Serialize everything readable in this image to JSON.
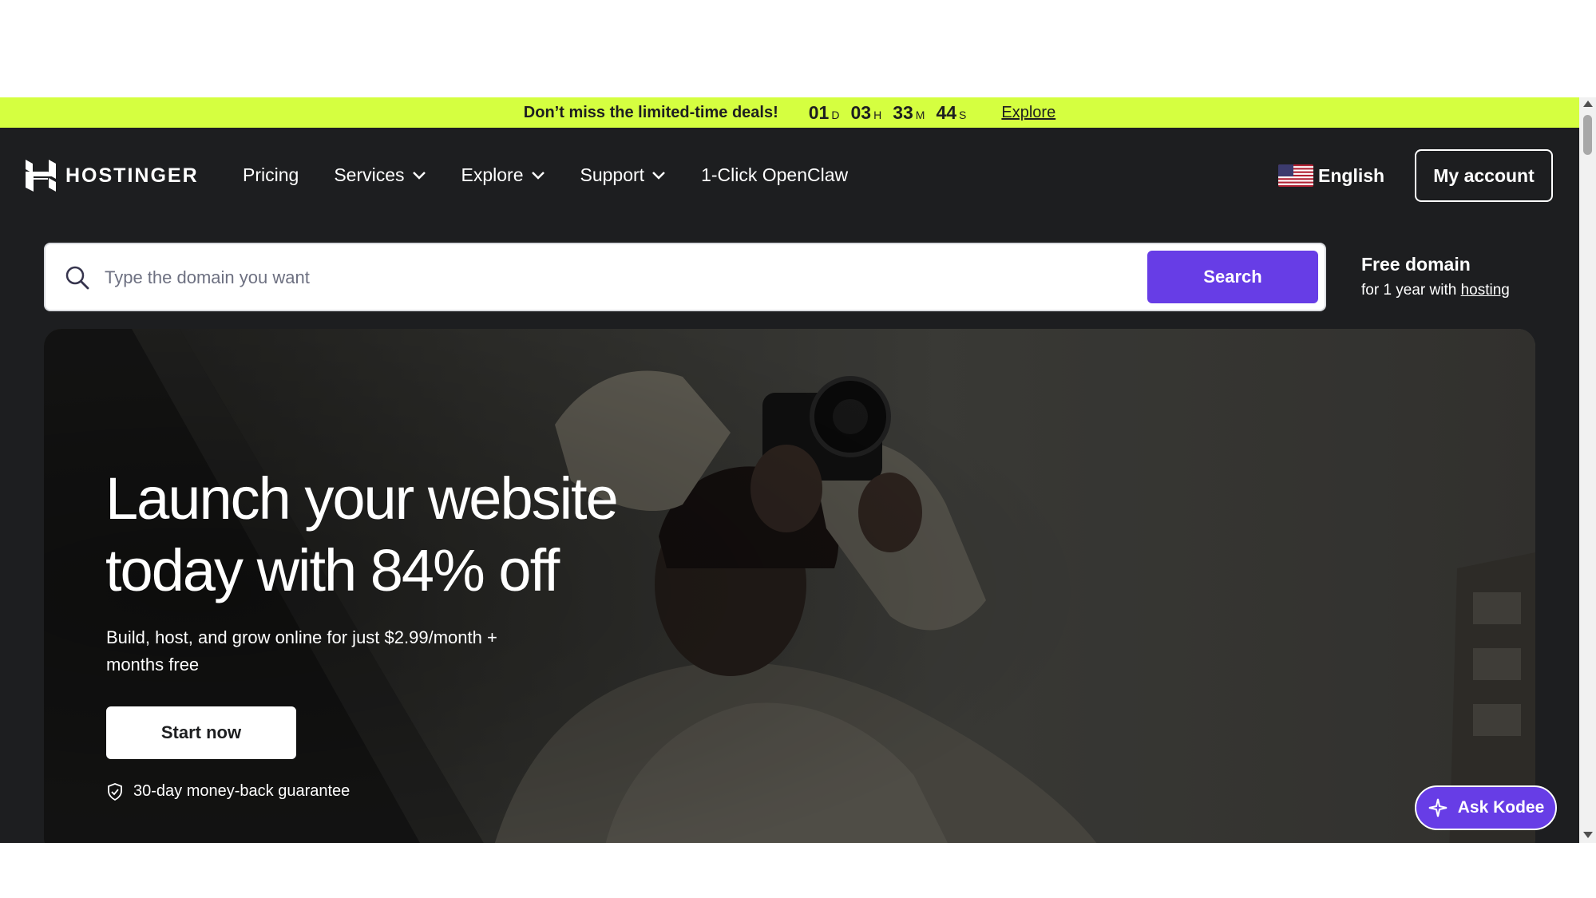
{
  "promo": {
    "message": "Don’t miss the limited-time deals!",
    "countdown": [
      {
        "value": "01",
        "unit": "D"
      },
      {
        "value": "03",
        "unit": "H"
      },
      {
        "value": "33",
        "unit": "M"
      },
      {
        "value": "44",
        "unit": "S"
      }
    ],
    "link": "Explore",
    "bg_color": "#d5ff40"
  },
  "header": {
    "logo": "HOSTINGER",
    "nav": [
      {
        "label": "Pricing",
        "dropdown": false
      },
      {
        "label": "Services",
        "dropdown": true
      },
      {
        "label": "Explore",
        "dropdown": true
      },
      {
        "label": "Support",
        "dropdown": true
      },
      {
        "label": "1-Click OpenClaw",
        "dropdown": false
      }
    ],
    "language": "English",
    "account_button": "My account"
  },
  "search": {
    "placeholder": "Type the domain you want",
    "button": "Search",
    "promo_title": "Free domain",
    "promo_text": "for 1 year with",
    "promo_link": "hosting"
  },
  "hero": {
    "title_line1": "Launch your website",
    "title_line2": "today with 84% off",
    "subtitle": "Build, host, and grow online for just $2.99/month + months free",
    "cta": "Start now",
    "guarantee": "30-day money-back guarantee"
  },
  "assistant": {
    "label": "Ask Kodee"
  },
  "colors": {
    "brand_purple": "#673de6",
    "dark_bg": "#1d1e20",
    "promo_lime": "#d5ff40"
  }
}
